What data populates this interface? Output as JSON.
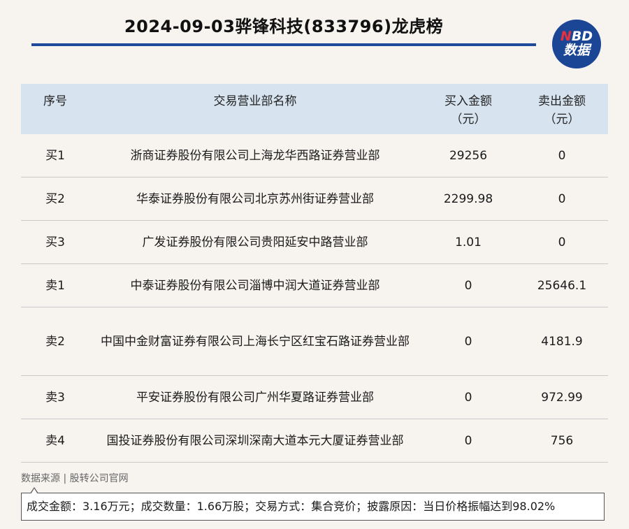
{
  "header": {
    "title": "2024-09-03骅锋科技(833796)龙虎榜",
    "logo_line1_accent": "N",
    "logo_line1_rest": "BD",
    "logo_line2": "数据"
  },
  "table": {
    "columns": [
      "序号",
      "交易营业部名称",
      "买入金额\n（元）",
      "卖出金额\n（元）"
    ],
    "rows": [
      {
        "rank": "买1",
        "name": "浙商证券股份有限公司上海龙华西路证券营业部",
        "buy": "29256",
        "sell": "0"
      },
      {
        "rank": "买2",
        "name": "华泰证券股份有限公司北京苏州街证券营业部",
        "buy": "2299.98",
        "sell": "0"
      },
      {
        "rank": "买3",
        "name": "广发证券股份有限公司贵阳延安中路营业部",
        "buy": "1.01",
        "sell": "0"
      },
      {
        "rank": "卖1",
        "name": "中泰证券股份有限公司淄博中润大道证券营业部",
        "buy": "0",
        "sell": "25646.1"
      },
      {
        "rank": "卖2",
        "name": "中国中金财富证券有限公司上海长宁区红宝石路证券营业部",
        "buy": "0",
        "sell": "4181.9"
      },
      {
        "rank": "卖3",
        "name": "平安证券股份有限公司广州华夏路证券营业部",
        "buy": "0",
        "sell": "972.99"
      },
      {
        "rank": "卖4",
        "name": "国投证券股份有限公司深圳深南大道本元大厦证券营业部",
        "buy": "0",
        "sell": "756"
      }
    ]
  },
  "footer": {
    "source": "数据来源 | 股转公司官网",
    "summary": "成交金额：3.16万元；成交数量：1.66万股；交易方式：集合竞价；披露原因：当日价格振幅达到98.02%"
  }
}
